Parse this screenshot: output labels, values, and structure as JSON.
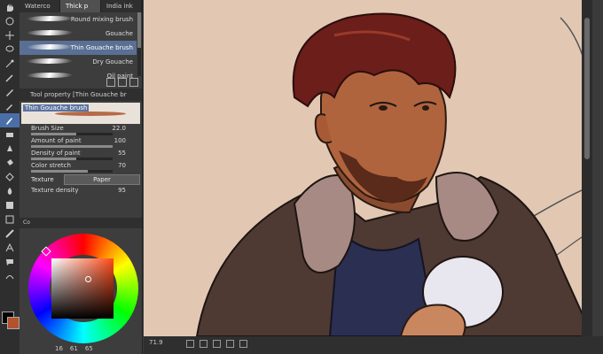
{
  "brush_panel": {
    "tabs": [
      "Waterco",
      "Thick p",
      "India ink"
    ],
    "brushes": [
      {
        "name": "Round mixing brush",
        "selected": false
      },
      {
        "name": "Gouache",
        "selected": false
      },
      {
        "name": "Thin Gouache brush",
        "selected": true
      },
      {
        "name": "Dry Gouache",
        "selected": false
      },
      {
        "name": "Oil paint",
        "selected": false
      }
    ]
  },
  "tool_property": {
    "header": "Tool property [Thin Gouache br",
    "preview_name": "Thin Gouache brush",
    "rows": [
      {
        "label": "Brush Size",
        "value": "22.0",
        "fill": 0.55
      },
      {
        "label": "Amount of paint",
        "value": "100",
        "fill": 1.0
      },
      {
        "label": "Density of paint",
        "value": "55",
        "fill": 0.55
      },
      {
        "label": "Color stretch",
        "value": "70",
        "fill": 0.7
      }
    ],
    "texture_label": "Texture",
    "texture_value": "Paper",
    "texture_density_label": "Texture density",
    "texture_density_value": "95"
  },
  "color_panel": {
    "tab_label": "Co",
    "status": [
      "16",
      "61",
      "65"
    ],
    "main_color": "#b3522b",
    "sub_color": "#000000"
  },
  "status_bar": {
    "zoom": "71.9"
  }
}
